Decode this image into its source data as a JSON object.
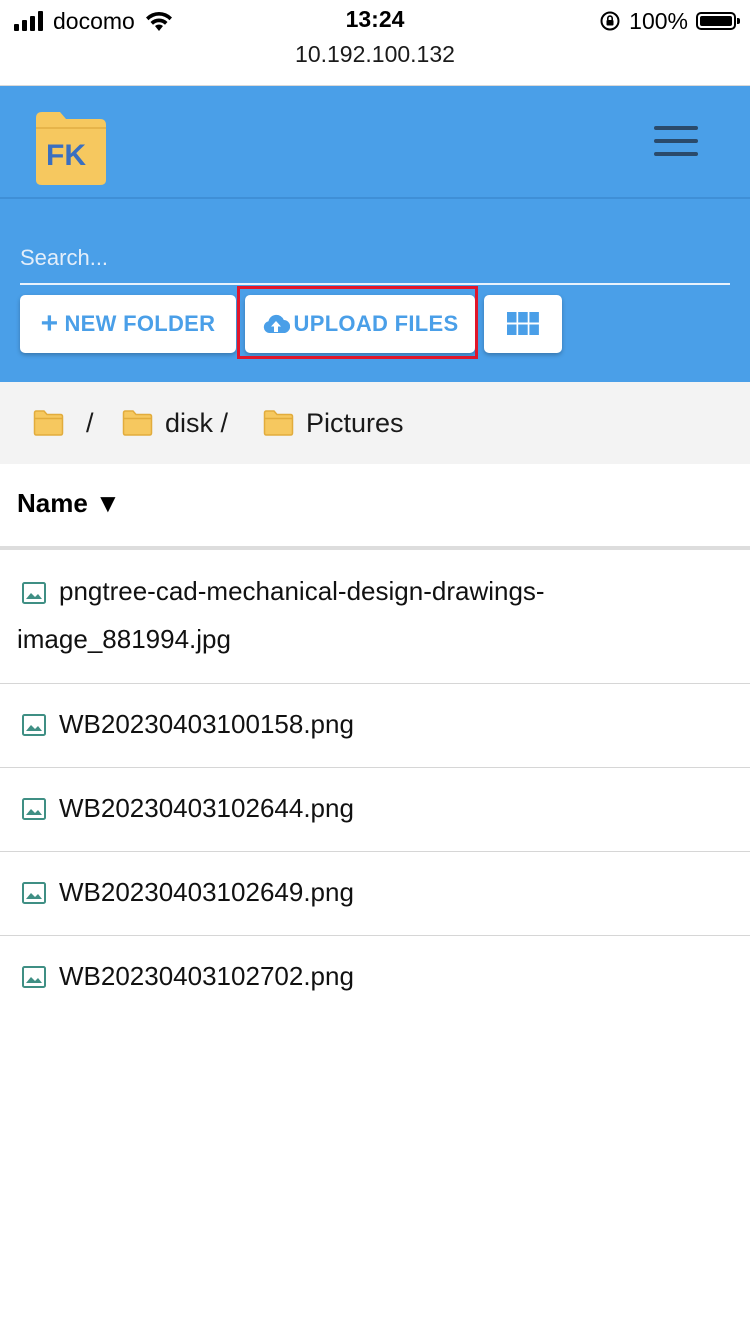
{
  "status_bar": {
    "carrier": "docomo",
    "time": "13:24",
    "url": "10.192.100.132",
    "battery": "100%"
  },
  "app": {
    "logo_text": "FK",
    "menu_icon": "hamburger-menu-icon"
  },
  "search": {
    "placeholder": "Search..."
  },
  "actions": {
    "new_folder": "NEW FOLDER",
    "upload_files": "UPLOAD FILES",
    "grid_view_icon": "grid-view-icon"
  },
  "breadcrumb": [
    {
      "label": "/"
    },
    {
      "label": "disk /"
    },
    {
      "label": "Pictures"
    }
  ],
  "list_header": {
    "name": "Name ▼"
  },
  "files": [
    {
      "name": "pngtree-cad-mechanical-design-drawings-image_881994.jpg"
    },
    {
      "name": "WB20230403100158.png"
    },
    {
      "name": "WB20230403102644.png"
    },
    {
      "name": "WB20230403102649.png"
    },
    {
      "name": "WB20230403102702.png"
    }
  ],
  "colors": {
    "primary": "#4a9fe8",
    "highlight": "#e0162b",
    "folder": "#f6c85f",
    "file_icon": "#3f8f84"
  }
}
